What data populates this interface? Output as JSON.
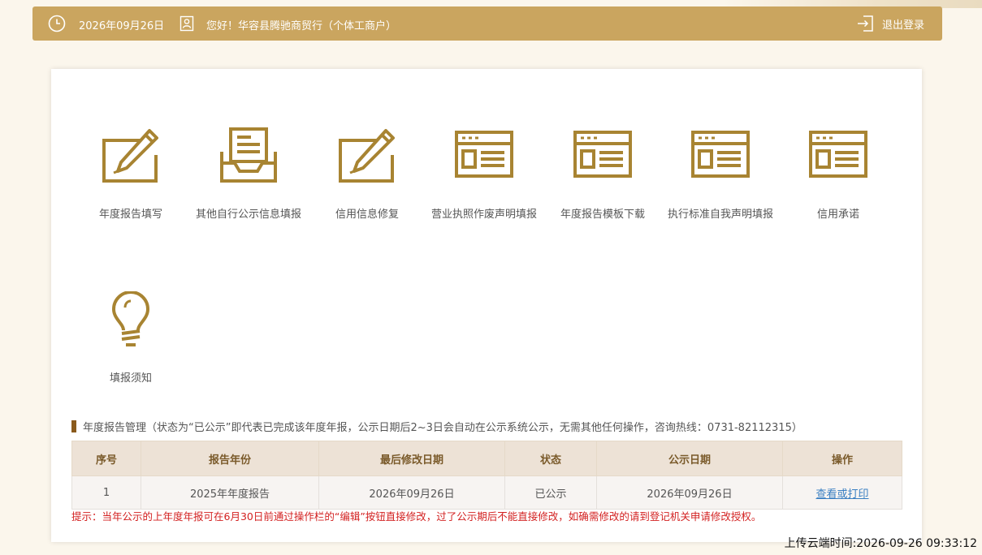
{
  "header": {
    "date": "2026年09月26日",
    "greeting": "您好！华容县腾驰商贸行（个体工商户）",
    "logout_label": "退出登录"
  },
  "menu": [
    {
      "label": "年度报告填写",
      "icon": "edit-pencil-icon"
    },
    {
      "label": "其他自行公示信息填报",
      "icon": "inbox-document-icon"
    },
    {
      "label": "信用信息修复",
      "icon": "edit-pencil-icon"
    },
    {
      "label": "营业执照作废声明填报",
      "icon": "window-card-icon"
    },
    {
      "label": "年度报告模板下载",
      "icon": "window-card-icon"
    },
    {
      "label": "执行标准自我声明填报",
      "icon": "window-card-icon"
    },
    {
      "label": "信用承诺",
      "icon": "window-card-icon"
    },
    {
      "label": "填报须知",
      "icon": "lightbulb-icon"
    }
  ],
  "section": {
    "title": "年度报告管理（状态为“已公示”即代表已完成该年度年报，公示日期后2~3日会自动在公示系统公示，无需其他任何操作，咨询热线：0731-82112315）"
  },
  "table": {
    "headers": [
      "序号",
      "报告年份",
      "最后修改日期",
      "状态",
      "公示日期",
      "操作"
    ],
    "rows": [
      {
        "index": "1",
        "year": "2025年年度报告",
        "modified": "2026年09月26日",
        "status": "已公示",
        "publish_date": "2026年09月26日",
        "action": "查看或打印"
      }
    ]
  },
  "tip": "提示：当年公示的上年度年报可在6月30日前通过操作栏的“编辑”按钮直接修改，过了公示期后不能直接修改，如确需修改的请到登记机关申请修改授权。",
  "upload_time": "上传云端时间:2026-09-26 09:33:12",
  "colors": {
    "brand_gold": "#caa55f",
    "icon_gold": "#a88432",
    "tip_red": "#d32222",
    "link_blue": "#3a7fc2"
  }
}
